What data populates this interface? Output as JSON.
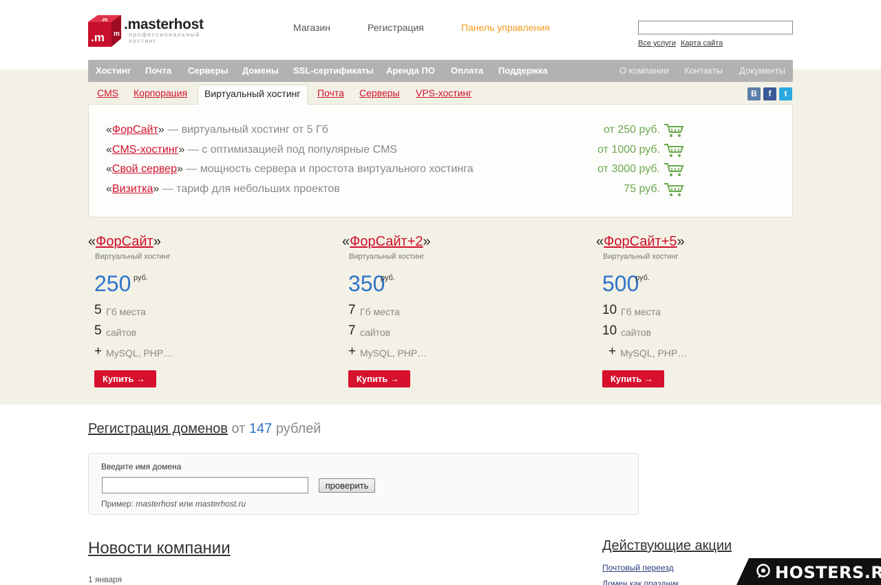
{
  "header": {
    "logo_text": ".masterhost",
    "logo_sub": "профессиональный хостинг",
    "nav": [
      "Магазин",
      "Регистрация",
      "Панель управления"
    ],
    "search_links": [
      "Все услуги",
      "Карта сайта"
    ]
  },
  "main_nav": {
    "items": [
      "Хостинг",
      "Почта",
      "Серверы",
      "Домены",
      "SSL-сертификаты",
      "Аренда ПО",
      "Оплата",
      "Поддержка"
    ],
    "right_items": [
      "О компании",
      "Контакты",
      "Документы"
    ]
  },
  "sub_tabs": [
    "CMS",
    "Корпорация",
    "Виртуальный хостинг",
    "Почта",
    "Серверы",
    "VPS-хостинг"
  ],
  "social": [
    "В",
    "f",
    "t"
  ],
  "offers": [
    {
      "name": "ФорСайт",
      "desc": " — виртуальный хостинг от 5 Гб",
      "price": "от 250 руб."
    },
    {
      "name": "CMS-хостинг",
      "desc": " — с оптимизацией под популярные CMS",
      "price": "от 1000 руб."
    },
    {
      "name": "Свой сервер",
      "desc": " — мощность сервера и простота виртуального хостинга",
      "price": "от 3000 руб."
    },
    {
      "name": "Визитка",
      "desc": " — тариф для небольших проектов",
      "price": "75 руб."
    }
  ],
  "quote_open": "«",
  "quote_close": "»",
  "plans": [
    {
      "name": "ФорСайт",
      "sub": "Виртуальный хостинг",
      "price": "250",
      "currency": "руб.",
      "disk": "5",
      "disk_label": "Гб места",
      "sites": "5",
      "sites_label": "сайтов",
      "extra_sign": "+",
      "extra": "MySQL, PHP…",
      "buy": "Купить →"
    },
    {
      "name": "ФорСайт+2",
      "sub": "Виртуальный хостинг",
      "price": "350",
      "currency": "руб.",
      "disk": "7",
      "disk_label": "Гб места",
      "sites": "7",
      "sites_label": "сайтов",
      "extra_sign": "+",
      "extra": "MySQL, PHP…",
      "buy": "Купить →"
    },
    {
      "name": "ФорСайт+5",
      "sub": "Виртуальный хостинг",
      "price": "500",
      "currency": "руб.",
      "disk": "10",
      "disk_label": "Гб места",
      "sites": "10",
      "sites_label": "сайтов",
      "extra_sign": "+",
      "extra": "MySQL, PHP…",
      "buy": "Купить →"
    }
  ],
  "domains": {
    "title_link": "Регистрация доменов",
    "title_from": " от ",
    "price": "147",
    "title_unit": " рублей",
    "label": "Введите имя домена",
    "button": "проверить",
    "example_prefix": "Пример: ",
    "example_1": "masterhost",
    "example_or": " или ",
    "example_2": "masterhost.ru"
  },
  "news": {
    "title": "Новости компании",
    "date": "1 января"
  },
  "promos": {
    "title": "Действующие акции",
    "items": [
      "Почтовый переезд",
      "Домен как праздник"
    ]
  },
  "watermark": "HOSTERS.RU",
  "colors": {
    "brand_red": "#d7102e",
    "accent_orange": "#f29b1d",
    "price_blue": "#2e74c9",
    "price_green": "#6aa84f",
    "nav_grey": "#b2b2b2",
    "beige": "#f3f1e6"
  }
}
